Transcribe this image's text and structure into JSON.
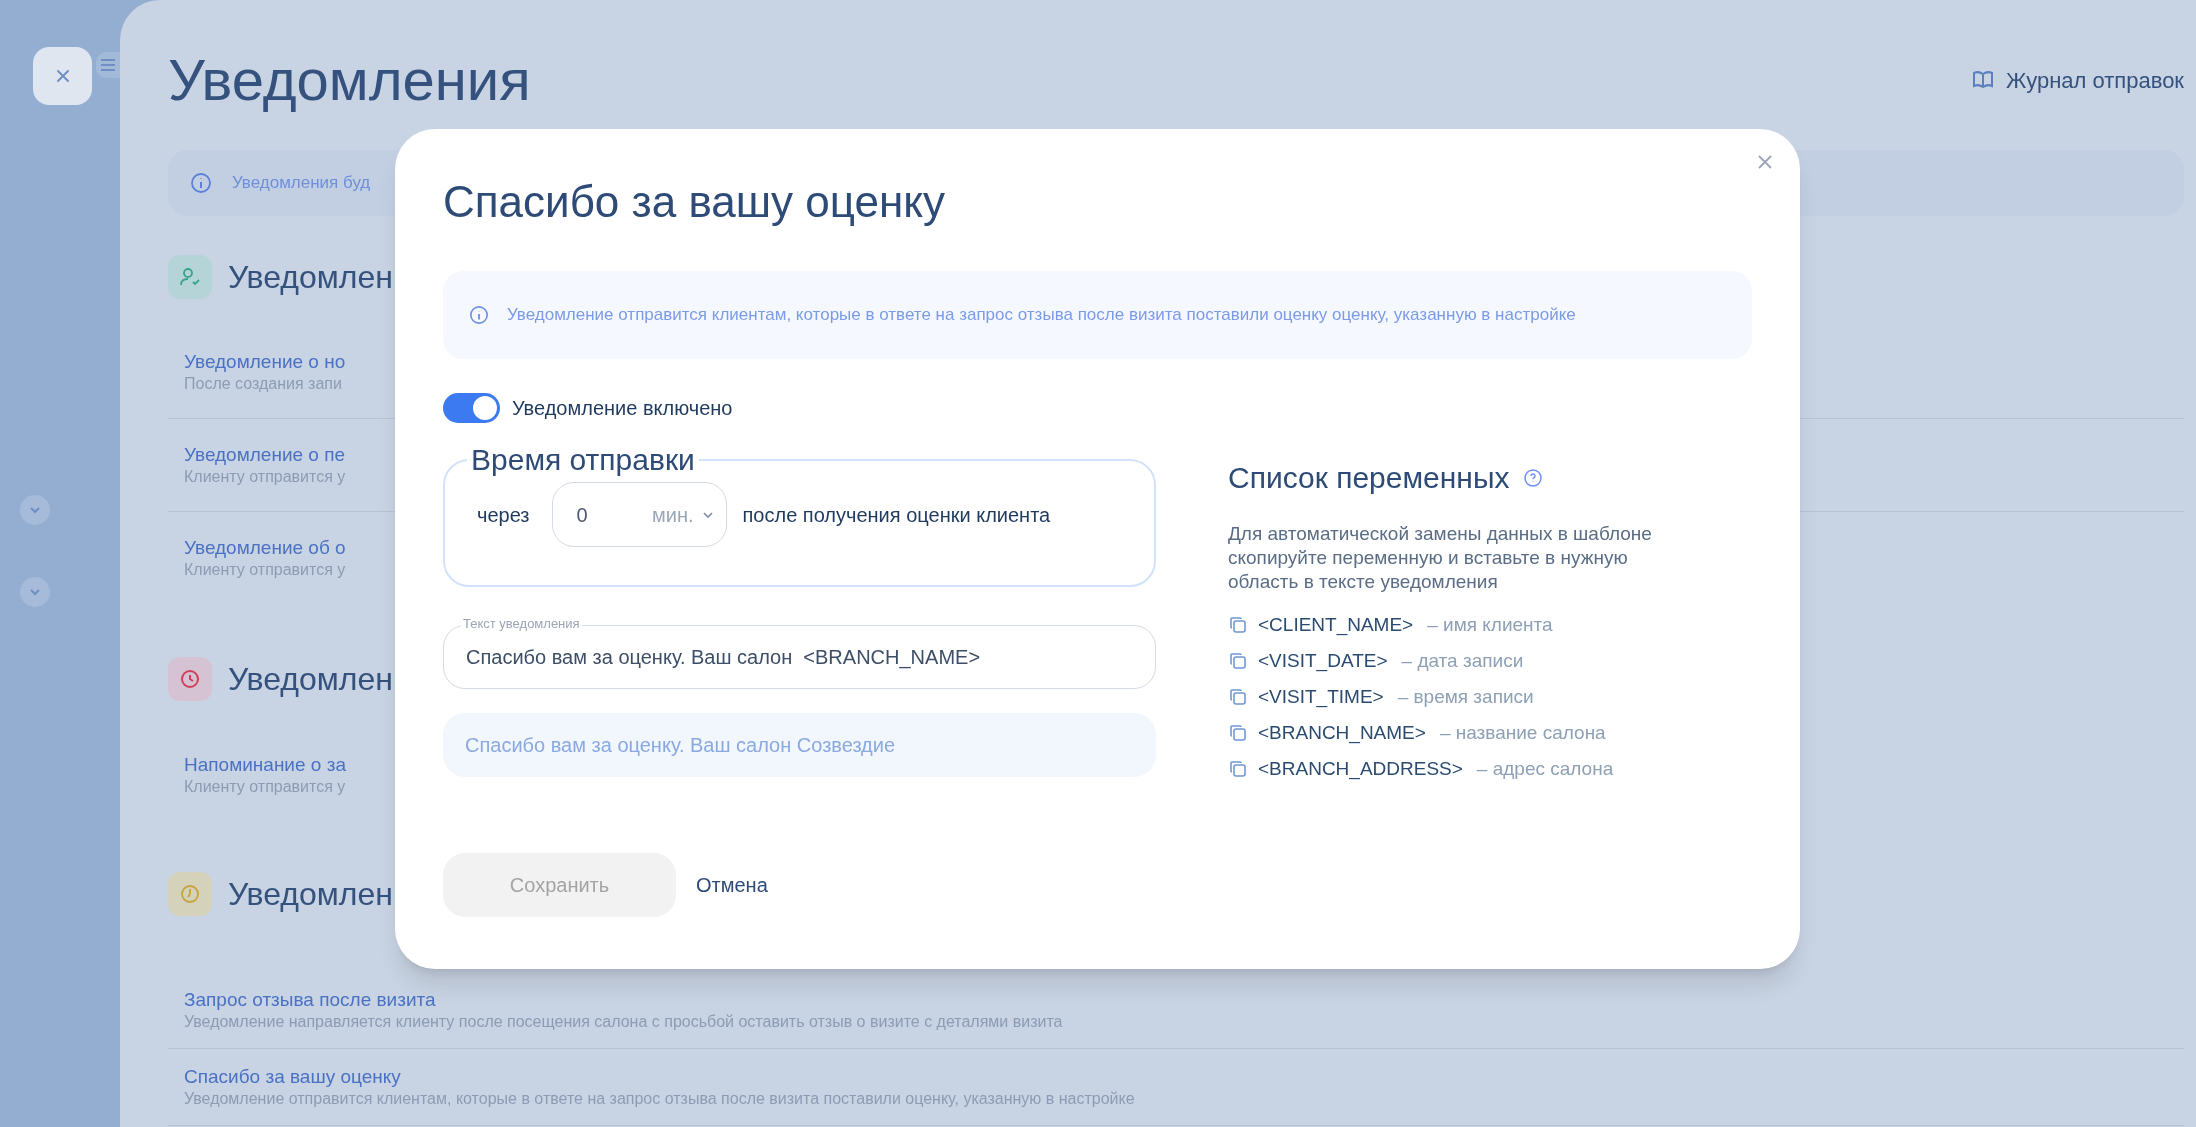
{
  "background": {
    "title": "Уведомления",
    "log_link": "Журнал отправок",
    "info": "Уведомления буд",
    "sections": [
      {
        "kind": "person",
        "title": "Уведомлен",
        "items": [
          {
            "title": "Уведомление о но",
            "subtitle": "После создания запи"
          },
          {
            "title": "Уведомление о пе",
            "subtitle": "Клиенту отправится у"
          },
          {
            "title": "Уведомление об о",
            "subtitle": "Клиенту отправится у"
          }
        ]
      },
      {
        "kind": "alarm",
        "title": "Уведомлен",
        "items": [
          {
            "title": "Напоминание о за",
            "subtitle": "Клиенту отправится у"
          }
        ]
      },
      {
        "kind": "clock",
        "title": "Уведомлен",
        "items": [
          {
            "title": "Запрос отзыва после визита",
            "subtitle": "Уведомление направляется клиенту после посещения салона с просьбой оставить отзыв о визите с деталями визита"
          },
          {
            "title": "Спасибо за вашу оценку",
            "subtitle": "Уведомление отправится клиентам, которые в ответе на запрос отзыва после визита поставили оценку, указанную в настройке"
          }
        ]
      }
    ]
  },
  "modal": {
    "title": "Спасибо за вашу оценку",
    "info": "Уведомление отправится клиентам, которые в ответе на запрос отзыва после визита поставили оценку оценку, указанную в настройке",
    "toggle": {
      "label": "Уведомление включено",
      "on": true
    },
    "send_time": {
      "legend": "Время отправки",
      "before": "через",
      "value": "0",
      "unit": "мин.",
      "after": "после получения оценки клиента"
    },
    "text_field": {
      "label": "Текст уведомления",
      "value": "Спасибо вам за оценку. Ваш салон  <BRANCH_NAME>"
    },
    "preview": "Спасибо вам за оценку. Ваш салон Созвездие",
    "variables": {
      "title": "Список переменных",
      "description": "Для автоматической замены данных в шаблоне скопируйте переменную и вставьте в нужную область в тексте уведомления",
      "items": [
        {
          "name": "<CLIENT_NAME>",
          "description": "– имя клиента"
        },
        {
          "name": "<VISIT_DATE>",
          "description": "– дата записи"
        },
        {
          "name": "<VISIT_TIME>",
          "description": "– время записи"
        },
        {
          "name": "<BRANCH_NAME>",
          "description": "– название салона"
        },
        {
          "name": "<BRANCH_ADDRESS>",
          "description": "– адрес салона"
        }
      ]
    },
    "save_button": {
      "label": "Сохранить",
      "disabled": true
    },
    "cancel_button": "Отмена"
  }
}
